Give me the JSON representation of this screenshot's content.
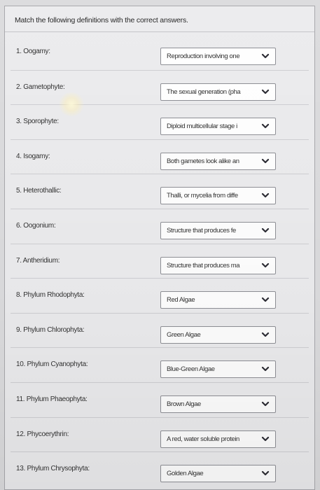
{
  "instruction": "Match the following definitions with the correct answers.",
  "icons": {
    "dropdown": "chevron-down-icon"
  },
  "items": [
    {
      "prompt": "1. Oogamy:",
      "selected": "Reproduction involving one"
    },
    {
      "prompt": "2. Gametophyte:",
      "selected": "The sexual generation (pha"
    },
    {
      "prompt": "3. Sporophyte:",
      "selected": "Diploid multicellular stage i"
    },
    {
      "prompt": "4. Isogamy:",
      "selected": "Both gametes look alike an"
    },
    {
      "prompt": "5. Heterothallic:",
      "selected": "Thalli, or mycelia from diffe"
    },
    {
      "prompt": "6. Oogonium:",
      "selected": "Structure that produces fe"
    },
    {
      "prompt": "7. Antheridium:",
      "selected": "Structure that produces ma"
    },
    {
      "prompt": "8. Phylum Rhodophyta:",
      "selected": "Red Algae"
    },
    {
      "prompt": "9. Phylum Chlorophyta:",
      "selected": "Green Algae"
    },
    {
      "prompt": "10. Phylum Cyanophyta:",
      "selected": "Blue-Green Algae"
    },
    {
      "prompt": "11. Phylum Phaeophyta:",
      "selected": "Brown Algae"
    },
    {
      "prompt": "12. Phycoerythrin:",
      "selected": "A red, water soluble protein"
    },
    {
      "prompt": "13. Phylum Chrysophyta:",
      "selected": "Golden Algae"
    }
  ]
}
